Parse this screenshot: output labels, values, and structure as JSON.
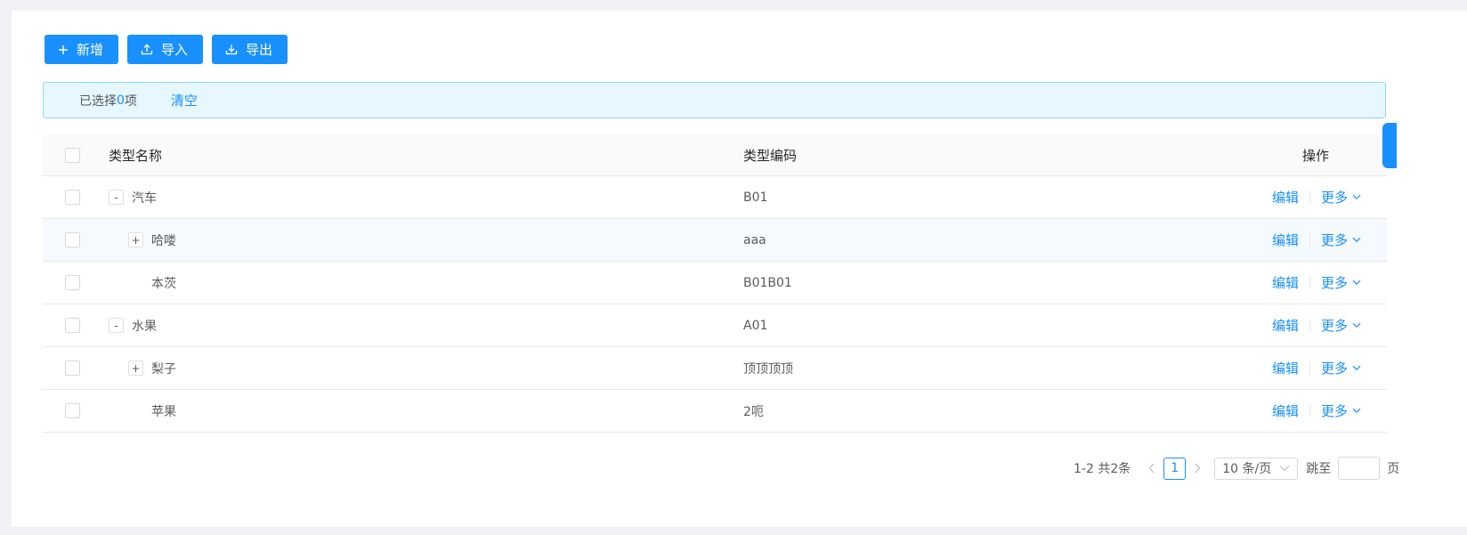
{
  "toolbar": {
    "add_label": "新增",
    "import_label": "导入",
    "export_label": "导出"
  },
  "selection": {
    "prefix": "已选择 ",
    "count": "0",
    "suffix": "项",
    "clear_label": "清空"
  },
  "table": {
    "headers": {
      "name": "类型名称",
      "code": "类型编码",
      "actions": "操作"
    },
    "rows": [
      {
        "name": "汽车",
        "code": "B01",
        "level": 0,
        "expander": "-",
        "highlight": false
      },
      {
        "name": "哈喽",
        "code": "aaa",
        "level": 1,
        "expander": "+",
        "highlight": true
      },
      {
        "name": "本茨",
        "code": "B01B01",
        "level": 1,
        "expander": "",
        "highlight": false
      },
      {
        "name": "水果",
        "code": "A01",
        "level": 0,
        "expander": "-",
        "highlight": false
      },
      {
        "name": "梨子",
        "code": "顶顶顶顶",
        "level": 1,
        "expander": "+",
        "highlight": false
      },
      {
        "name": "苹果",
        "code": "2呃",
        "level": 1,
        "expander": "",
        "highlight": false
      }
    ],
    "edit_label": "编辑",
    "more_label": "更多"
  },
  "pagination": {
    "total_text": "1-2 共2条",
    "current_page": "1",
    "page_size": "10 条/页",
    "jump_label": "跳至",
    "page_suffix": "页"
  },
  "colors": {
    "primary": "#1890ff",
    "alert_bg": "#e6f7ff",
    "alert_border": "#91d5ff"
  }
}
